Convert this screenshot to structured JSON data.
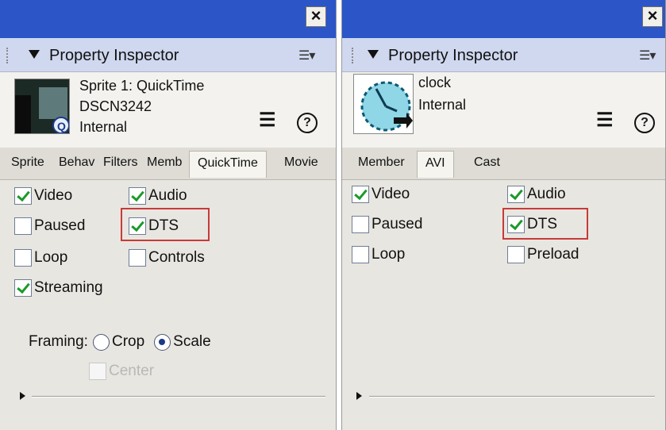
{
  "left": {
    "header": {
      "title": "Property Inspector"
    },
    "info": {
      "line1": "Sprite 1: QuickTime",
      "line2": "DSCN3242",
      "line3": "Internal"
    },
    "tabs": [
      "Sprite",
      "Behav",
      "Filters",
      "Memb",
      "QuickTime",
      "Movie"
    ],
    "checkboxes": {
      "video": "Video",
      "audio": "Audio",
      "paused": "Paused",
      "dts": "DTS",
      "loop": "Loop",
      "controls": "Controls",
      "streaming": "Streaming"
    },
    "framing": {
      "label": "Framing:",
      "crop": "Crop",
      "scale": "Scale",
      "center": "Center"
    }
  },
  "right": {
    "header": {
      "title": "Property Inspector"
    },
    "info": {
      "line1": "clock",
      "line2": "Internal"
    },
    "tabs": [
      "Member",
      "AVI",
      "Cast"
    ],
    "checkboxes": {
      "video": "Video",
      "audio": "Audio",
      "paused": "Paused",
      "dts": "DTS",
      "loop": "Loop",
      "preload": "Preload"
    }
  },
  "colors": {
    "titlebar": "#2c55c8",
    "highlight": "#c83a3a",
    "check": "#1a9a2a"
  }
}
